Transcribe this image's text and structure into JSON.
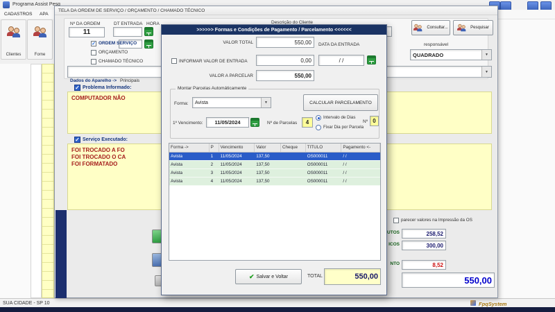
{
  "icons": {
    "chevron": "▼",
    "check": "✓",
    "save_check": "✔"
  },
  "colors": {
    "modal_title_bg": "#1a3363",
    "selection_blue": "#2a5cc8",
    "field_yellow": "#ffff9c",
    "area_yellow": "#ffffc6",
    "total_blue": "#0000cc",
    "alert_red": "#a51d1d"
  },
  "app": {
    "title": "Programa Assist Pesq",
    "menu": [
      {
        "label": "CADASTROS"
      },
      {
        "label": "APA"
      }
    ],
    "toolbar": [
      {
        "label": "Clientes"
      },
      {
        "label": "Forne"
      }
    ],
    "status_left": "SUA CIDADE - SP 10",
    "status_right": "FpqSystem"
  },
  "os_window": {
    "title": "TELA DA ORDEM DE SERVIÇO / ORÇAMENTO / CHAMADO TÉCNICO",
    "order_label": "Nº DA ORDEM",
    "order_value": "11",
    "dt_label": "DT ENTRADA",
    "hora_label": "HORA",
    "type_checks": [
      {
        "label": "ORDEM SERVIÇO",
        "checked": true
      },
      {
        "label": "ORÇAMENTO",
        "checked": false
      },
      {
        "label": "CHAMADO TÉCNICO",
        "checked": false
      }
    ],
    "client_label": "Descrição do Cliente",
    "consult_button": "Consultar...",
    "search_button": "Pesquisar",
    "responsible_label": "responsável",
    "responsible_value": "QUADRADO",
    "tab_device": "Dados do Aparelho ->",
    "tab_main": "Principais",
    "problem_label": "Problema Informado:",
    "problem_text": "COMPUTADOR NÃO",
    "service_label": "Serviço Executado:",
    "service_lines": [
      "FOI TROCADO A FO",
      "FOI TROCADO O CA",
      "FOI FORMATADO"
    ],
    "print_note": "parecer valores na Impressão da OS",
    "totals": [
      {
        "label": "UTOS",
        "value": "258,52"
      },
      {
        "label": "ICOS",
        "value": "300,00"
      },
      {
        "label": "NTO",
        "value": "8,52"
      }
    ],
    "grand_total": "550,00"
  },
  "modal": {
    "title": ">>>>>>  Formas e Condições de Pagamento / Parcelamento  <<<<<<",
    "valor_total_label": "VALOR TOTAL",
    "valor_total_value": "550,00",
    "entrada_check_label": "INFORMAR VALOR DE ENTRADA",
    "entrada_value": "0,00",
    "data_entrada_label": "DATA DA ENTRADA",
    "data_entrada_value": "/  /",
    "valor_parcelar_label": "VALOR A PARCELAR",
    "valor_parcelar_value": "550,00",
    "group_title": "Montar Parcelas Automáticamente",
    "forma_label": "Forma:",
    "forma_value": "Avista",
    "calc_button": "CALCULAR  PARCELAMENTO",
    "vencimento_label": "1º Vencimento:",
    "vencimento_value": "11/05/2024",
    "parcelas_label": "Nº de Parcelas",
    "parcelas_value": "4",
    "radio_intervalo": "Intervalo de Dias",
    "radio_fixar": "Fixar Dia por Parcela",
    "n_label": "Nº",
    "n_value": "0",
    "table": {
      "headers": [
        "Forma ->",
        "P",
        "Vencimento",
        "Valor",
        "Cheque",
        "TITULO",
        "Pagamento <-"
      ],
      "rows": [
        [
          "Avista",
          "1",
          "11/05/2024",
          "137,50",
          "",
          "OS000011",
          "/  /"
        ],
        [
          "Avista",
          "2",
          "11/05/2024",
          "137,50",
          "",
          "OS000011",
          "/  /"
        ],
        [
          "Avista",
          "3",
          "11/05/2024",
          "137,50",
          "",
          "OS000011",
          "/  /"
        ],
        [
          "Avista",
          "4",
          "11/05/2024",
          "137,50",
          "",
          "OS000011",
          "/  /"
        ]
      ],
      "selected_row": 0
    },
    "save_button": "Salvar e Voltar",
    "total_label": "TOTAL",
    "total_value": "550,00"
  }
}
